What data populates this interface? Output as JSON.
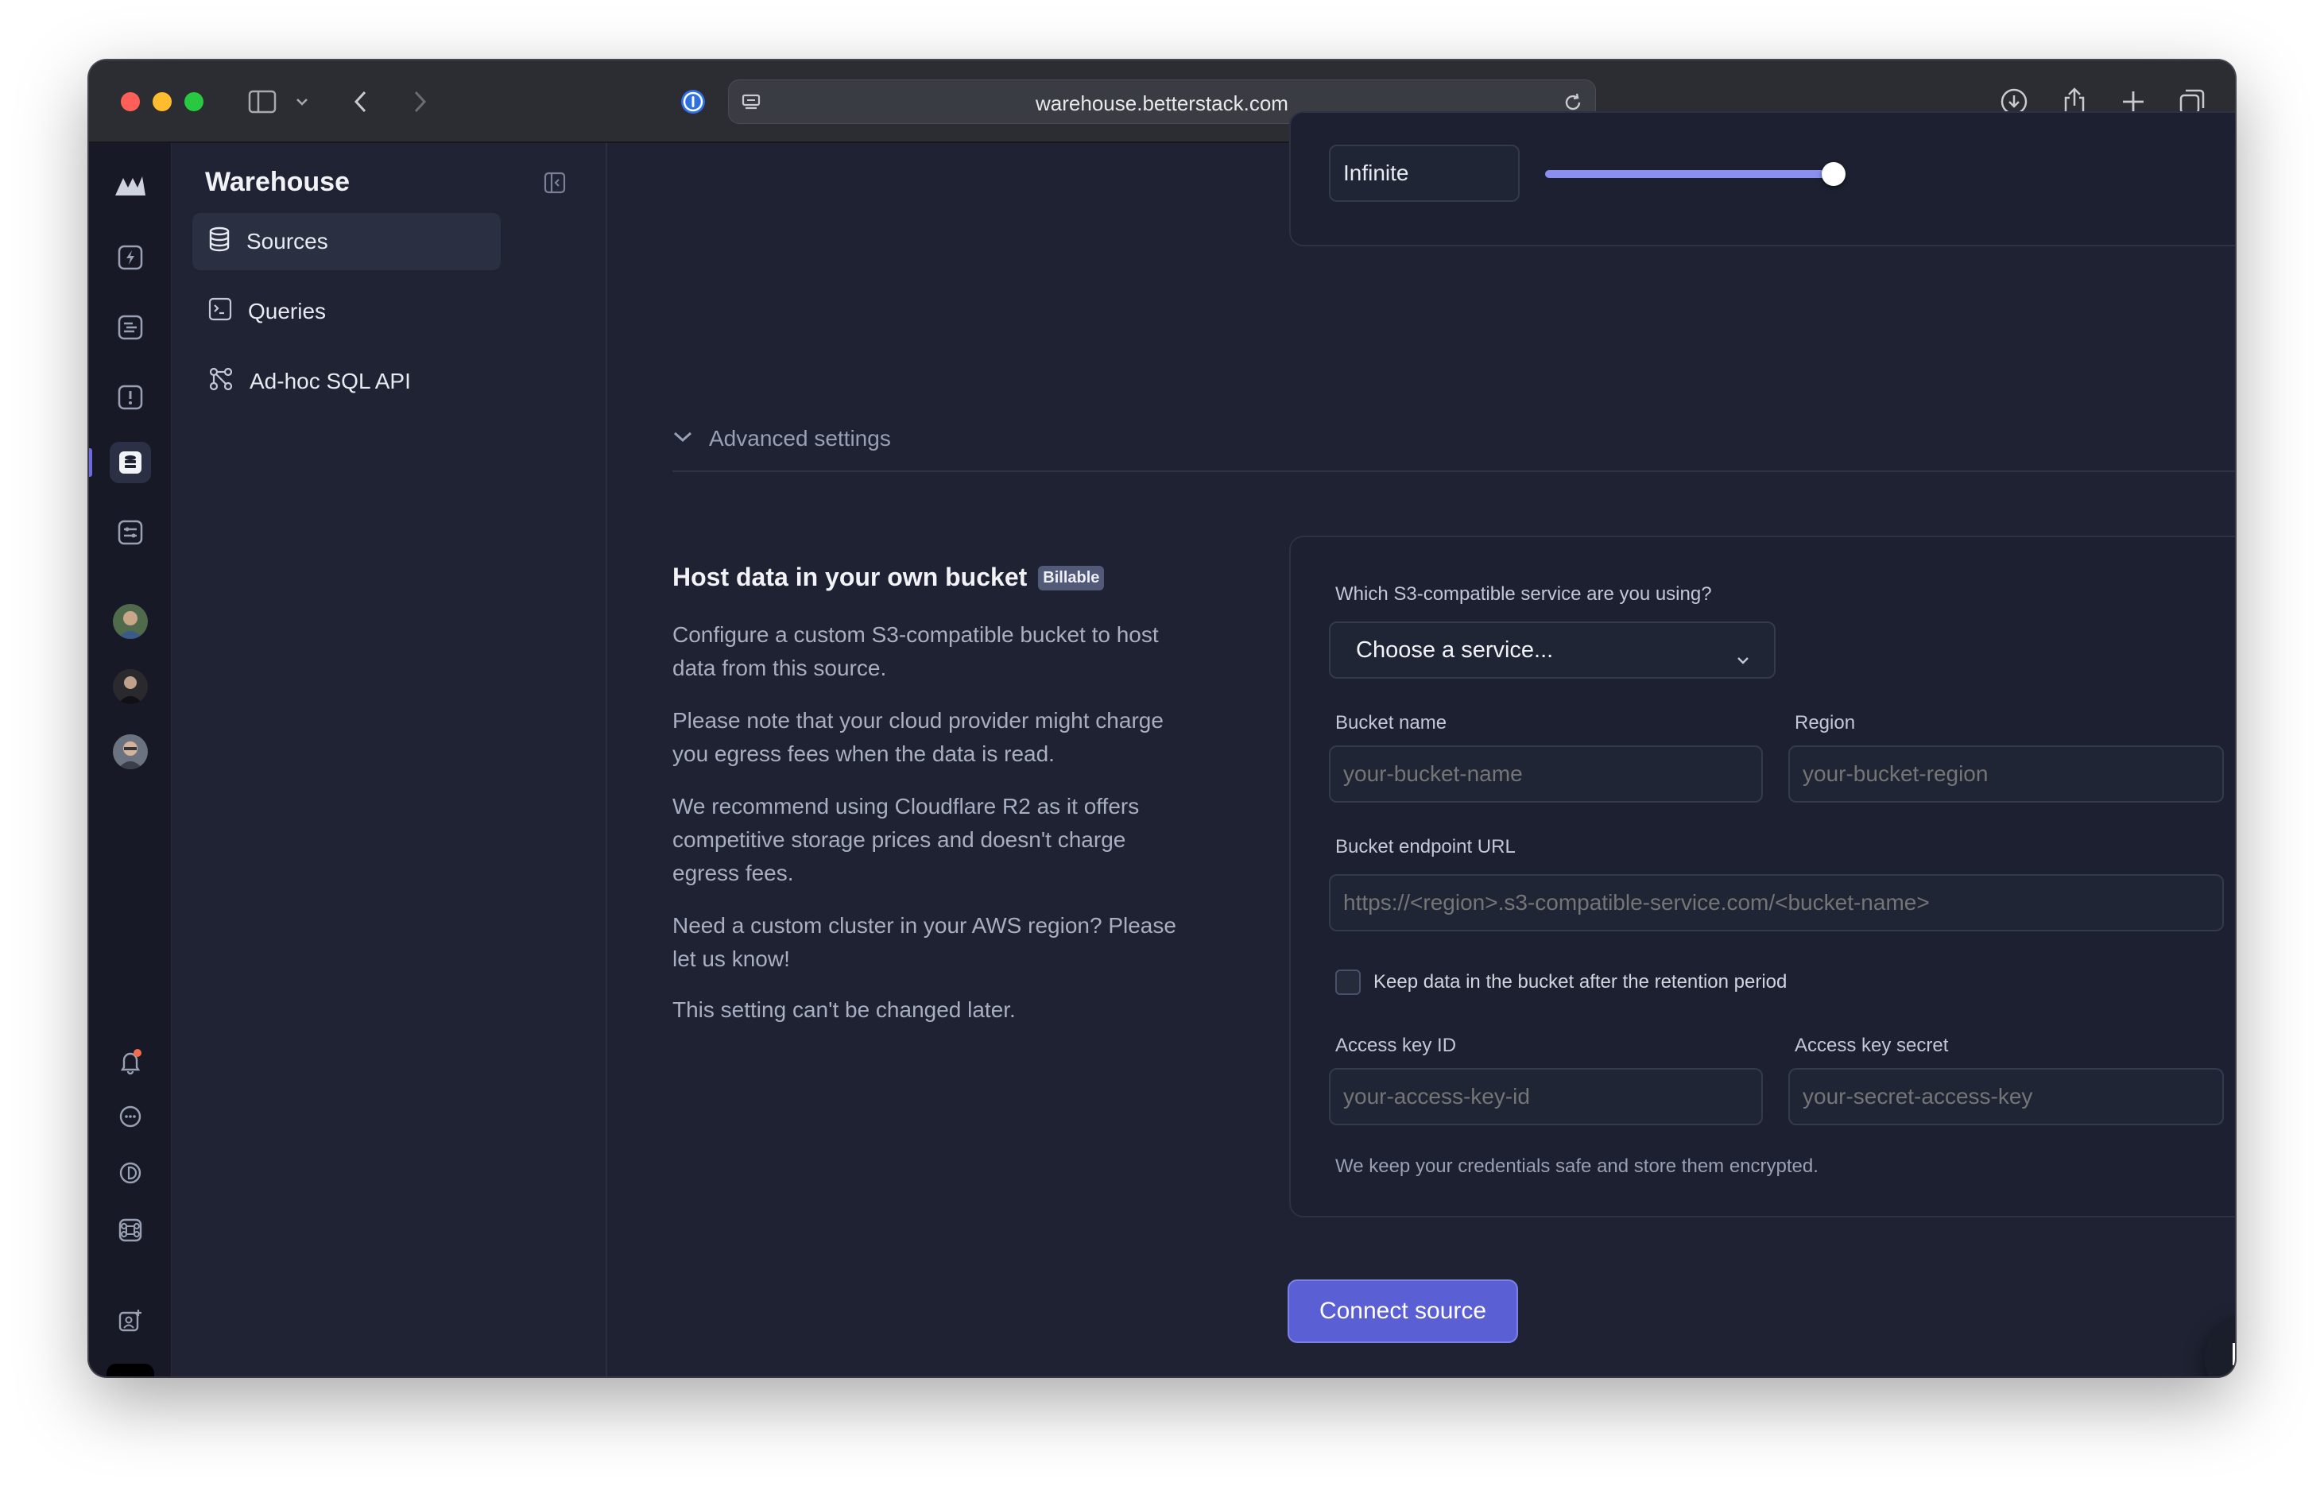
{
  "browser": {
    "url": "warehouse.betterstack.com"
  },
  "sidebar": {
    "title": "Warehouse",
    "items": [
      {
        "label": "Sources",
        "icon": "database-icon"
      },
      {
        "label": "Queries",
        "icon": "terminal-icon"
      },
      {
        "label": "Ad-hoc SQL API",
        "icon": "api-icon"
      }
    ]
  },
  "retention": {
    "value": "Infinite",
    "slider_fraction": 1.0
  },
  "advanced": {
    "label": "Advanced settings"
  },
  "bucket_section": {
    "heading": "Host data in your own bucket",
    "badge": "Billable",
    "paragraphs": [
      "Configure a custom S3-compatible bucket to host data from this source.",
      "Please note that your cloud provider might charge you egress fees when the data is read.",
      "We recommend using Cloudflare R2 as it offers competitive storage prices and doesn't charge egress fees.",
      "Need a custom cluster in your AWS region? Please let us know!",
      "This setting can't be changed later."
    ]
  },
  "form": {
    "service_label": "Which S3-compatible service are you using?",
    "service_value": "Choose a service...",
    "bucket_name_label": "Bucket name",
    "bucket_name_placeholder": "your-bucket-name",
    "region_label": "Region",
    "region_placeholder": "your-bucket-region",
    "endpoint_label": "Bucket endpoint URL",
    "endpoint_placeholder": "https://<region>.s3-compatible-service.com/<bucket-name>",
    "keep_data_label": "Keep data in the bucket after the retention period",
    "keep_data_checked": false,
    "access_key_id_label": "Access key ID",
    "access_key_id_placeholder": "your-access-key-id",
    "access_key_secret_label": "Access key secret",
    "access_key_secret_placeholder": "your-secret-access-key",
    "note": "We keep your credentials safe and store them encrypted."
  },
  "actions": {
    "connect_label": "Connect source"
  },
  "colors": {
    "accent": "#5b5fd4",
    "background": "#1e2232",
    "sidebar": "#1f2333",
    "rail": "#171a26"
  }
}
